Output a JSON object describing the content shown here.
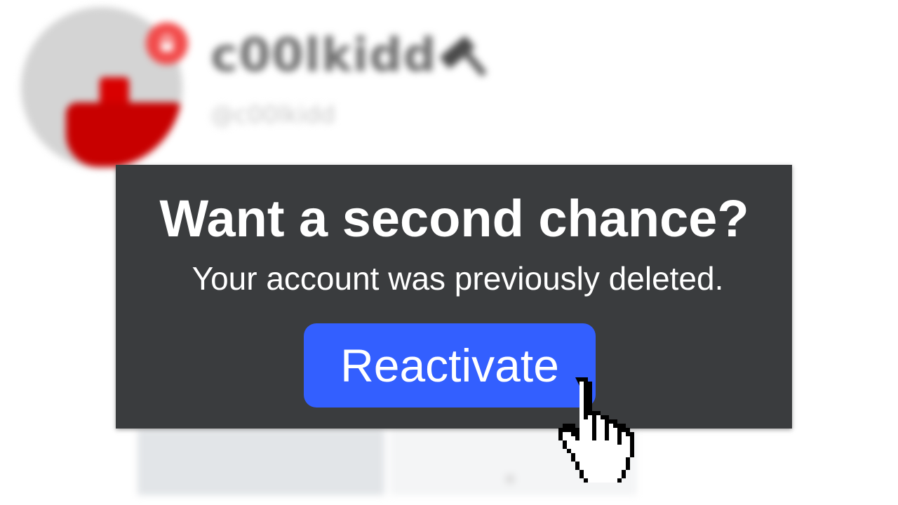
{
  "profile": {
    "display_name": "c00lkidd",
    "handle": "@c00lkidd",
    "avatar_badge_icon": "lock-icon",
    "name_badge_icon": "hammer-icon"
  },
  "dialog": {
    "title": "Want a second chance?",
    "message": "Your account was previously deleted.",
    "primary_button_label": "Reactivate"
  },
  "cursor": {
    "icon": "hand-pointer-icon"
  },
  "colors": {
    "dialog_background": "#3a3c3e",
    "button_background": "#335fff",
    "badge_red": "#f24b4b",
    "avatar_red": "#c80000"
  }
}
